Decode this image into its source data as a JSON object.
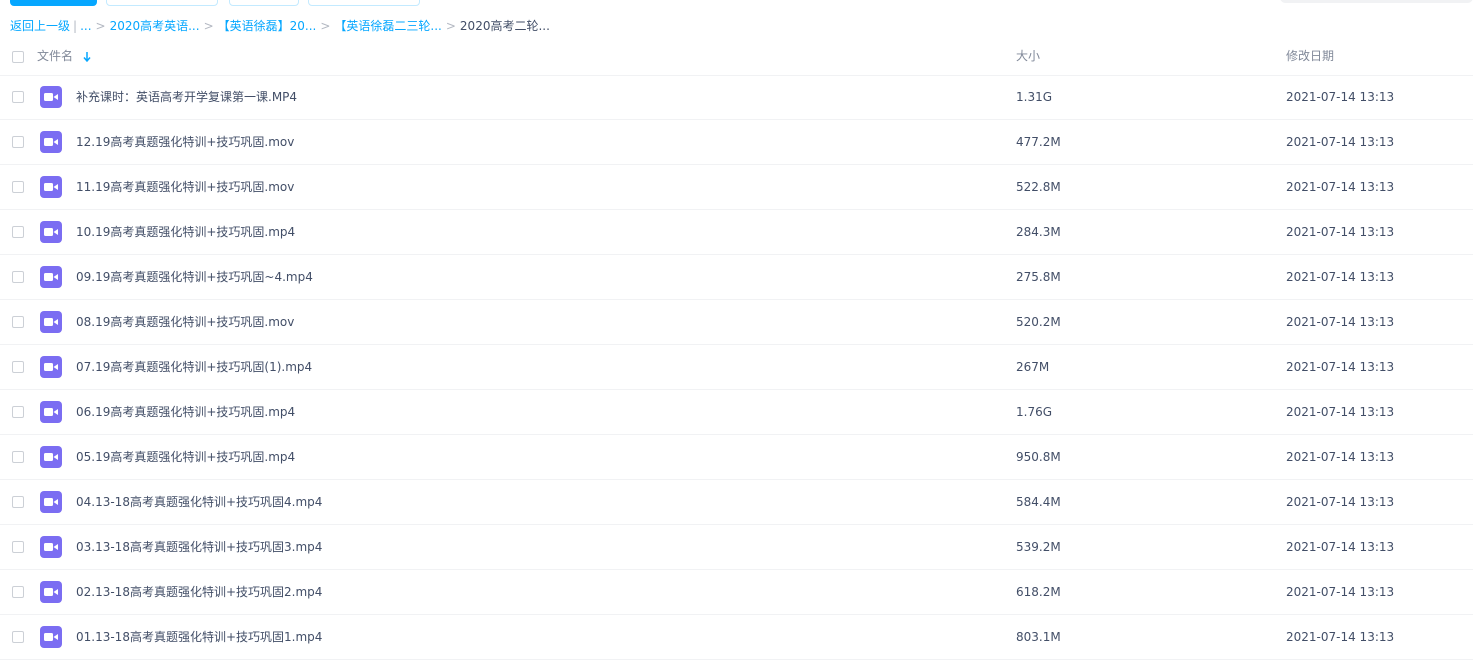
{
  "breadcrumb": {
    "back": "返回上一级",
    "divider": "|",
    "ellipsis": "...",
    "sep": ">",
    "crumbs": [
      "2020高考英语...",
      "【英语徐磊】20...",
      "【英语徐磊二三轮..."
    ],
    "current": "2020高考二轮..."
  },
  "columns": {
    "name": "文件名",
    "size": "大小",
    "date": "修改日期"
  },
  "sort_icon": "arrow-down-icon",
  "file_icon": "video-file-icon",
  "colors": {
    "accent": "#06a7ff",
    "video_icon": "#7b6df2",
    "text": "#424e67",
    "muted": "#818999"
  },
  "files": [
    {
      "name": "补充课时：英语高考开学复课第一课.MP4",
      "size": "1.31G",
      "date": "2021-07-14 13:13"
    },
    {
      "name": "12.19高考真题强化特训+技巧巩固.mov",
      "size": "477.2M",
      "date": "2021-07-14 13:13"
    },
    {
      "name": "11.19高考真题强化特训+技巧巩固.mov",
      "size": "522.8M",
      "date": "2021-07-14 13:13"
    },
    {
      "name": "10.19高考真题强化特训+技巧巩固.mp4",
      "size": "284.3M",
      "date": "2021-07-14 13:13"
    },
    {
      "name": "09.19高考真题强化特训+技巧巩固~4.mp4",
      "size": "275.8M",
      "date": "2021-07-14 13:13"
    },
    {
      "name": "08.19高考真题强化特训+技巧巩固.mov",
      "size": "520.2M",
      "date": "2021-07-14 13:13"
    },
    {
      "name": "07.19高考真题强化特训+技巧巩固(1).mp4",
      "size": "267M",
      "date": "2021-07-14 13:13"
    },
    {
      "name": "06.19高考真题强化特训+技巧巩固.mp4",
      "size": "1.76G",
      "date": "2021-07-14 13:13"
    },
    {
      "name": "05.19高考真题强化特训+技巧巩固.mp4",
      "size": "950.8M",
      "date": "2021-07-14 13:13"
    },
    {
      "name": "04.13-18高考真题强化特训+技巧巩固4.mp4",
      "size": "584.4M",
      "date": "2021-07-14 13:13"
    },
    {
      "name": "03.13-18高考真题强化特训+技巧巩固3.mp4",
      "size": "539.2M",
      "date": "2021-07-14 13:13"
    },
    {
      "name": "02.13-18高考真题强化特训+技巧巩固2.mp4",
      "size": "618.2M",
      "date": "2021-07-14 13:13"
    },
    {
      "name": "01.13-18高考真题强化特训+技巧巩固1.mp4",
      "size": "803.1M",
      "date": "2021-07-14 13:13"
    }
  ]
}
